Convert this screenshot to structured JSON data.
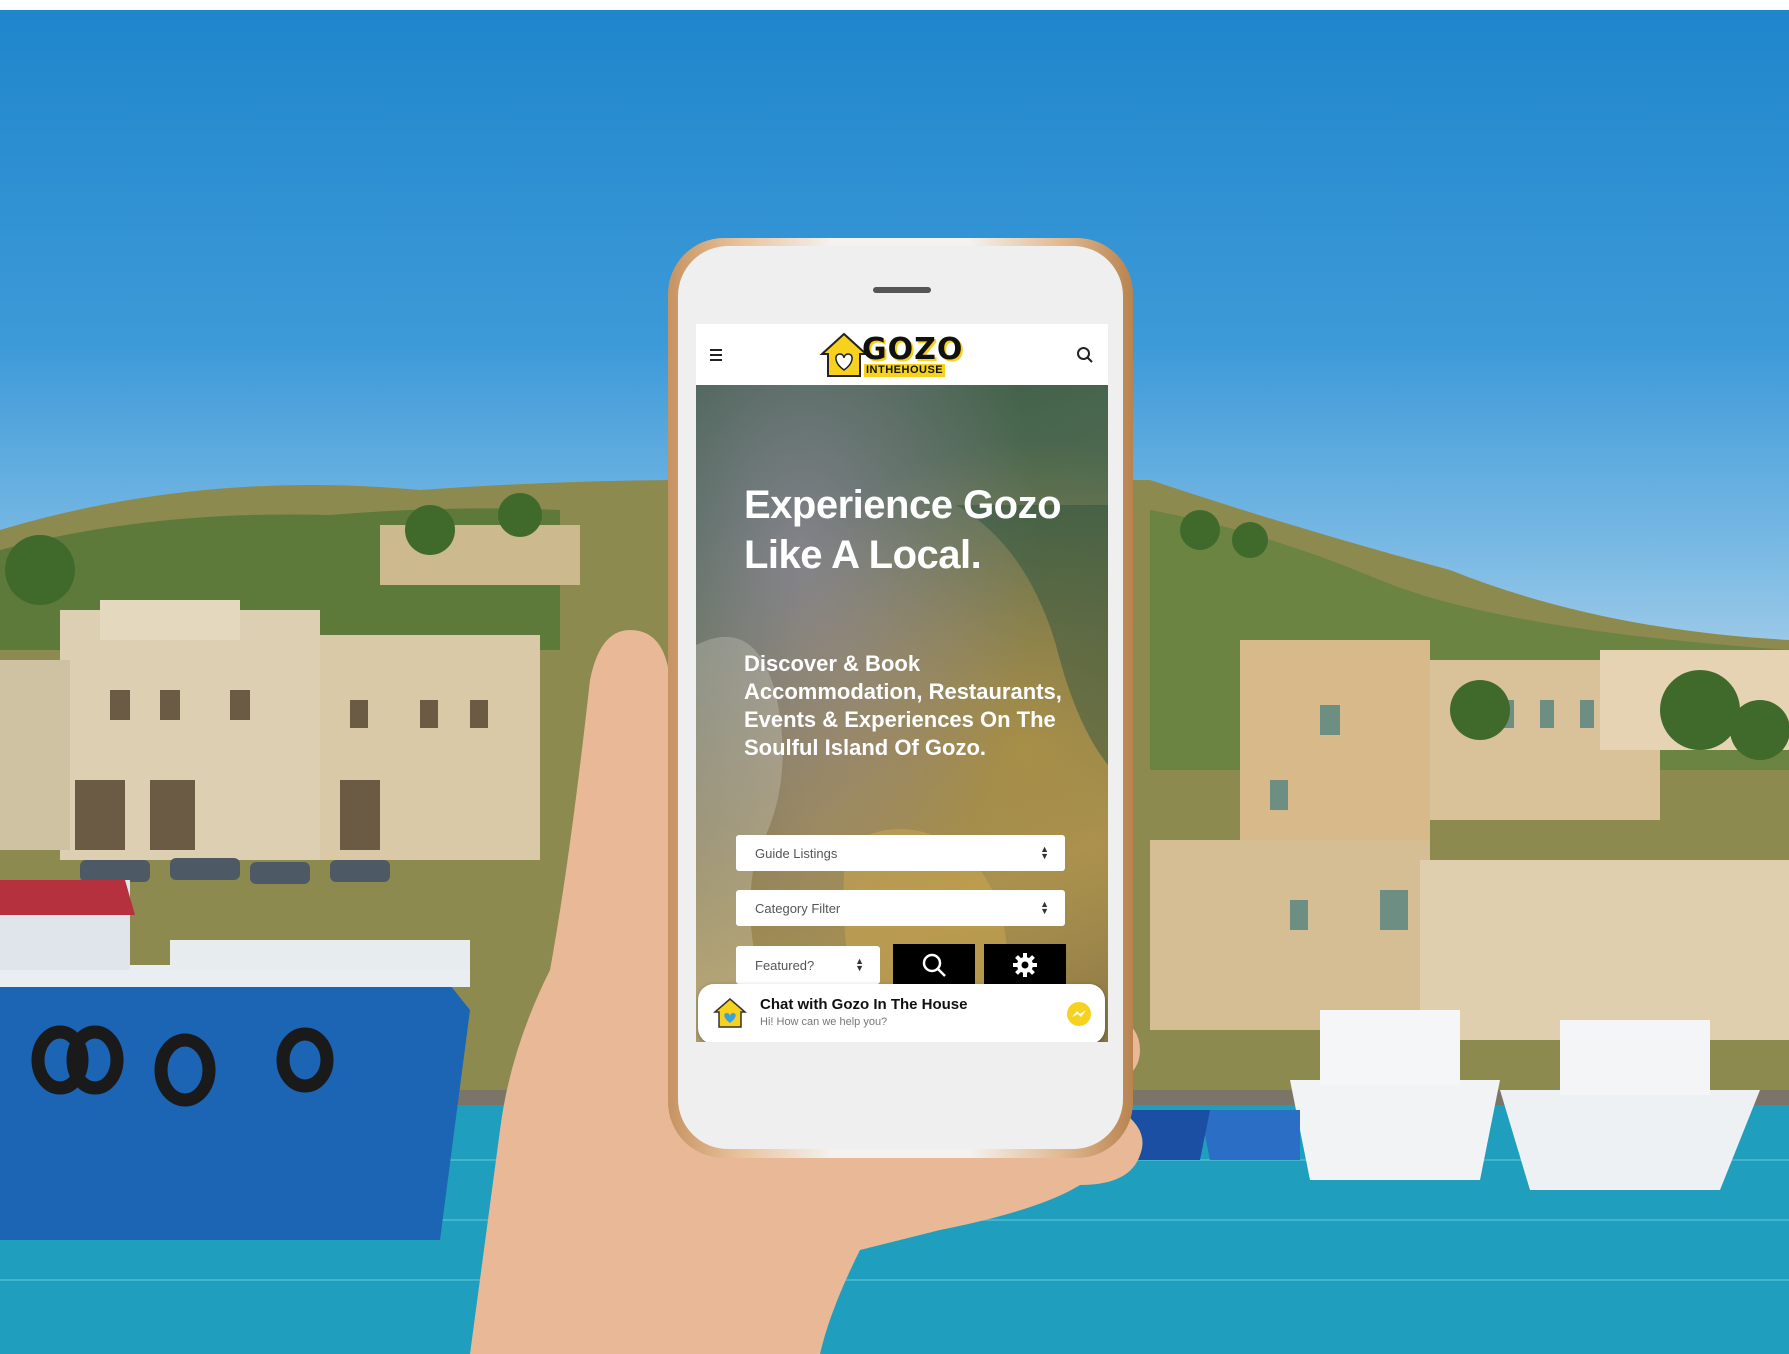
{
  "site": {
    "logo": {
      "main": "GOZO",
      "sub": "INTHEHOUSE"
    },
    "menu_icon": "hamburger-icon",
    "search_icon": "search-icon"
  },
  "hero": {
    "title": "Experience Gozo Like A Local.",
    "subtitle": "Discover & Book Accommodation, Restaurants, Events & Experiences On The Soulful Island Of Gozo."
  },
  "filters": {
    "guide_listings": "Guide Listings",
    "category_filter": "Category Filter",
    "featured": "Featured?"
  },
  "buttons": {
    "search_icon": "search-icon",
    "settings_icon": "gear-icon"
  },
  "chat": {
    "title": "Chat with Gozo In The House",
    "subtitle": "Hi! How can we help you?",
    "icon": "messenger-icon"
  },
  "colors": {
    "brand_yellow": "#f6d21f",
    "black": "#000000",
    "sky": "#3d9ad8",
    "sea": "#1fa3c2"
  }
}
